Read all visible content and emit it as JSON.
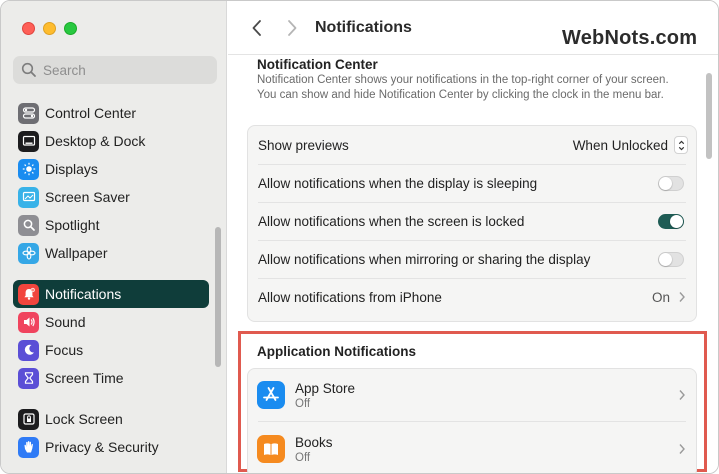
{
  "sidebar": {
    "search_placeholder": "Search",
    "items": [
      {
        "label": "Control Center",
        "icon": "control-center-icon",
        "color": "#6e6e73"
      },
      {
        "label": "Desktop & Dock",
        "icon": "desktop-dock-icon",
        "color": "#1c1c1e"
      },
      {
        "label": "Displays",
        "icon": "displays-icon",
        "color": "#1a8cf0"
      },
      {
        "label": "Screen Saver",
        "icon": "screen-saver-icon",
        "color": "#38b2e8"
      },
      {
        "label": "Spotlight",
        "icon": "spotlight-icon",
        "color": "#8e8e93"
      },
      {
        "label": "Wallpaper",
        "icon": "wallpaper-icon",
        "color": "#35a7e6"
      },
      {
        "label": "Notifications",
        "icon": "notifications-icon",
        "color": "#f1453d",
        "active": true
      },
      {
        "label": "Sound",
        "icon": "sound-icon",
        "color": "#f0445e"
      },
      {
        "label": "Focus",
        "icon": "focus-icon",
        "color": "#5b4fd6"
      },
      {
        "label": "Screen Time",
        "icon": "screen-time-icon",
        "color": "#5b4fd6"
      },
      {
        "label": "Lock Screen",
        "icon": "lock-screen-icon",
        "color": "#1c1c1e"
      },
      {
        "label": "Privacy & Security",
        "icon": "privacy-icon",
        "color": "#2f7bf6"
      }
    ]
  },
  "toolbar": {
    "title": "Notifications"
  },
  "watermark": "WebNots.com",
  "notification_center": {
    "heading": "Notification Center",
    "description": "Notification Center shows your notifications in the top-right corner of your screen. You can show and hide Notification Center by clicking the clock in the menu bar.",
    "show_previews_label": "Show previews",
    "show_previews_value": "When Unlocked",
    "sleeping_label": "Allow notifications when the display is sleeping",
    "sleeping_on": false,
    "locked_label": "Allow notifications when the screen is locked",
    "locked_on": true,
    "mirroring_label": "Allow notifications when mirroring or sharing the display",
    "mirroring_on": false,
    "iphone_label": "Allow notifications from iPhone",
    "iphone_value": "On"
  },
  "app_notifications": {
    "heading": "Application Notifications",
    "apps": [
      {
        "name": "App Store",
        "status": "Off",
        "icon": "app-store-icon",
        "color": "#1a8cf0"
      },
      {
        "name": "Books",
        "status": "Off",
        "icon": "books-icon",
        "color": "#f58a1f"
      }
    ]
  },
  "colors": {
    "sidebar_active": "#0f3d3a",
    "toggle_on": "#1f5c55",
    "highlight_border": "#e05a4f"
  }
}
